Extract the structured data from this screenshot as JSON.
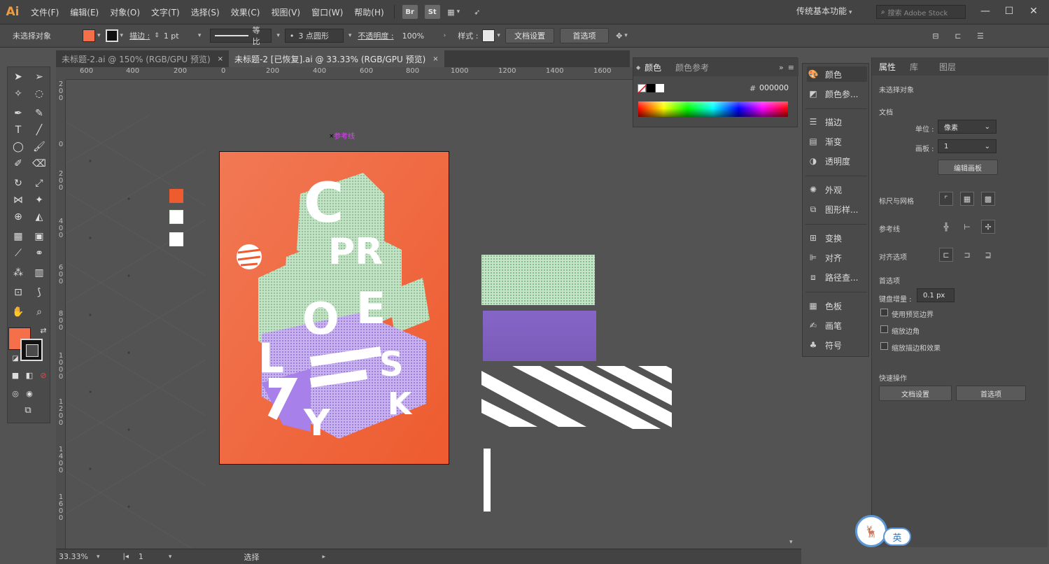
{
  "app": {
    "logo": "Ai"
  },
  "menu": [
    "文件(F)",
    "编辑(E)",
    "对象(O)",
    "文字(T)",
    "选择(S)",
    "效果(C)",
    "视图(V)",
    "窗口(W)",
    "帮助(H)"
  ],
  "menu_icons": {
    "bridge": "Br",
    "stock": "St"
  },
  "workspace": "传统基本功能",
  "search_placeholder": "搜索 Adobe Stock",
  "control": {
    "selection_state": "未选择对象",
    "fill_color": "#f5704a",
    "stroke_label": "描边 :",
    "stroke_weight": "1 pt",
    "stroke_profile": "等比",
    "brush": "3 点圆形",
    "opacity_label": "不透明度 :",
    "opacity": "100%",
    "style_label": "样式 :",
    "doc_setup": "文档设置",
    "preferences": "首选项"
  },
  "tabs": [
    {
      "label": "未标题-2.ai @ 150% (RGB/GPU 预览)",
      "close": "×",
      "active": false
    },
    {
      "label": "未标题-2 [已恢复].ai @ 33.33% (RGB/GPU 预览)",
      "close": "×",
      "active": true
    }
  ],
  "ruler_top": [
    "600",
    "400",
    "200",
    "0",
    "200",
    "400",
    "600",
    "800",
    "1000",
    "1200",
    "1400",
    "1600"
  ],
  "ruler_left": [
    "200",
    "0",
    "200",
    "400",
    "600",
    "800",
    "1000",
    "1200",
    "1400",
    "1600"
  ],
  "canvas": {
    "guide_label": "参考线",
    "swatches": [
      "#ee5b2f",
      "#ffffff",
      "#ffffff"
    ],
    "artboard_color": "#ee5b2f",
    "poster_letters": [
      "C",
      "PR",
      "O",
      "E",
      "L",
      "S",
      "K",
      "Y"
    ]
  },
  "status": {
    "zoom": "33.33%",
    "artboard": "1",
    "tool": "选择"
  },
  "color_panel": {
    "tab_color": "颜色",
    "tab_guide": "颜色参考",
    "hex_label": "#",
    "hex": "000000"
  },
  "dock": [
    "颜色",
    "颜色参...",
    "描边",
    "渐变",
    "透明度",
    "外观",
    "图形样...",
    "变换",
    "对齐",
    "路径查...",
    "色板",
    "画笔",
    "符号"
  ],
  "props": {
    "tabs": [
      "属性",
      "库",
      "图层"
    ],
    "no_selection": "未选择对象",
    "document": "文档",
    "units_label": "单位 :",
    "units": "像素",
    "artboard_label": "画板 :",
    "artboard": "1",
    "edit_artboards": "编辑画板",
    "rulers_grids": "标尺与网格",
    "guides": "参考线",
    "snap": "对齐选项",
    "preferences": "首选项",
    "key_increment_label": "键盘增量 :",
    "key_increment": "0.1 px",
    "check1": "使用预览边界",
    "check2": "缩放边角",
    "check3": "缩放描边和效果",
    "quick_actions": "快速操作",
    "doc_setup": "文档设置",
    "prefs_btn": "首选项"
  },
  "ime": {
    "lang": "英"
  }
}
